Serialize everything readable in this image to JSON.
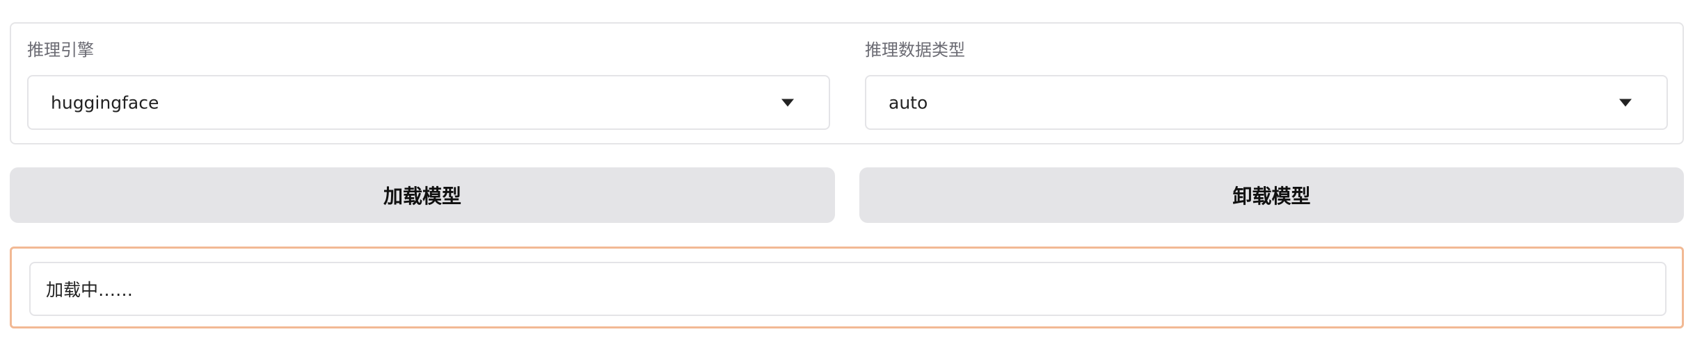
{
  "engine": {
    "label": "推理引擎",
    "value": "huggingface",
    "icon": "chevron-down-icon"
  },
  "dtype": {
    "label": "推理数据类型",
    "value": "auto",
    "icon": "chevron-down-icon"
  },
  "buttons": {
    "load": "加载模型",
    "unload": "卸载模型"
  },
  "status": {
    "text": "加载中……",
    "accent_color": "#f2b994"
  }
}
